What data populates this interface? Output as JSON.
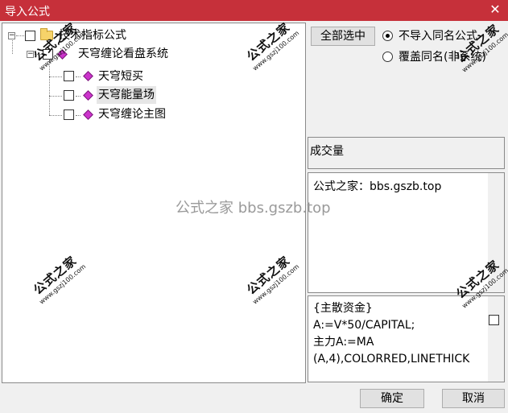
{
  "window": {
    "title": "导入公式",
    "close_glyph": "✕"
  },
  "tree": {
    "root": {
      "label": "技术指标公式",
      "expander": "−"
    },
    "group": {
      "label": "天穹缠论看盘系统",
      "expander": "−"
    },
    "items": [
      {
        "label": "天穹短买"
      },
      {
        "label": "天穹能量场"
      },
      {
        "label": "天穹缠论主图"
      }
    ]
  },
  "options": {
    "select_all": "全部选中",
    "radio_no_import": "不导入同名公式",
    "radio_overwrite": "覆盖同名(非系统)"
  },
  "info": {
    "volume_label": "成交量"
  },
  "description": {
    "text": "公式之家：bbs.gszb.top"
  },
  "code": {
    "lines": [
      "{主散资金}",
      "A:=V*50/CAPITAL;",
      "主力A:=MA",
      "(A,4),COLORRED,LINETHICK"
    ]
  },
  "footer": {
    "ok": "确定",
    "cancel": "取消"
  },
  "watermarks": {
    "brand": "公式之家",
    "site": "www.gszj100.com",
    "center": "公式之家 bbs.gszb.top"
  },
  "colors": {
    "titlebar": "#c6303a",
    "window_bg": "#f0f0f0"
  }
}
